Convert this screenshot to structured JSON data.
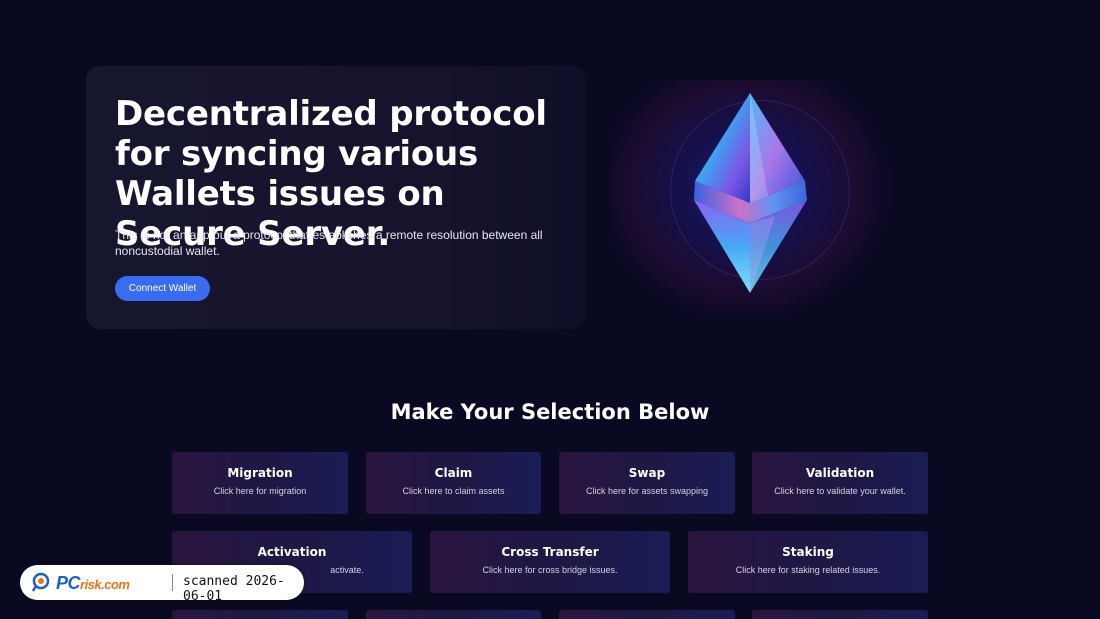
{
  "hero": {
    "title": "Decentralized protocol for syncing various Wallets issues on Secure Server.",
    "subtitle": "This is not an app but a protocol that establishes a remote resolution between all noncustodial wallet.",
    "connect_label": "Connect Wallet"
  },
  "section": {
    "title": "Make Your Selection Below",
    "cards": [
      {
        "title": "Migration",
        "desc": "Click here for migration"
      },
      {
        "title": "Claim",
        "desc": "Click here to claim assets"
      },
      {
        "title": "Swap",
        "desc": "Click here for assets swapping"
      },
      {
        "title": "Validation",
        "desc": "Click here to validate your wallet."
      },
      {
        "title": "Activation",
        "desc": "activate."
      },
      {
        "title": "Cross Transfer",
        "desc": "Click here for cross bridge issues."
      },
      {
        "title": "Staking",
        "desc": "Click here for staking related issues."
      }
    ]
  },
  "watermark": {
    "brand_pc": "PC",
    "brand_risk": "risk.com",
    "text": "scanned 2026-06-01"
  },
  "colors": {
    "background": "#0a0922",
    "button": "#3a6cf2",
    "card_from": "#2a1540",
    "card_to": "#1a1c55"
  },
  "icons": [
    "ethereum-logo",
    "pcrisk-logo"
  ]
}
